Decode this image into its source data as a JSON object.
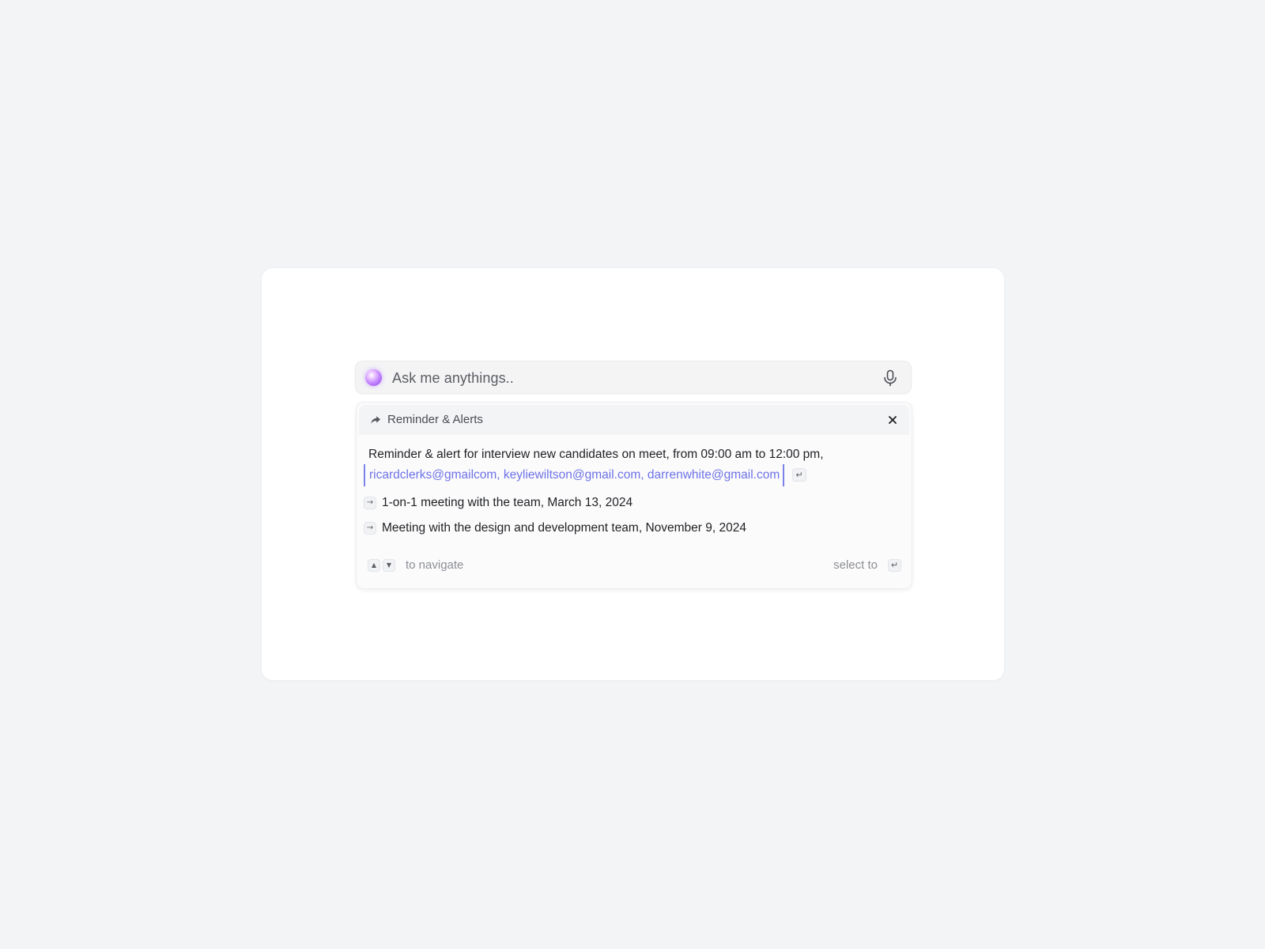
{
  "search": {
    "placeholder": "Ask me anythings.."
  },
  "panel": {
    "header_title": "Reminder & Alerts",
    "main_text": "Reminder & alert for interview new candidates on meet, from 09:00 am to 12:00 pm,",
    "emails_text": "ricardclerks@gmailcom, keyliewiltson@gmail.com, darrenwhite@gmail.com",
    "enter_symbol": "↵",
    "items": [
      {
        "label": "1-on-1 meeting with the team, March 13, 2024",
        "icon": "→"
      },
      {
        "label": "Meeting with the design and development team, November 9, 2024",
        "icon": "→"
      }
    ],
    "footer": {
      "up_symbol": "▲",
      "down_symbol": "▼",
      "navigate_label": "to navigate",
      "select_label": "select to",
      "enter_symbol": "↵"
    }
  },
  "colors": {
    "accent": "#6d72e6",
    "orb": "#b06eff",
    "background": "#f3f4f6"
  }
}
